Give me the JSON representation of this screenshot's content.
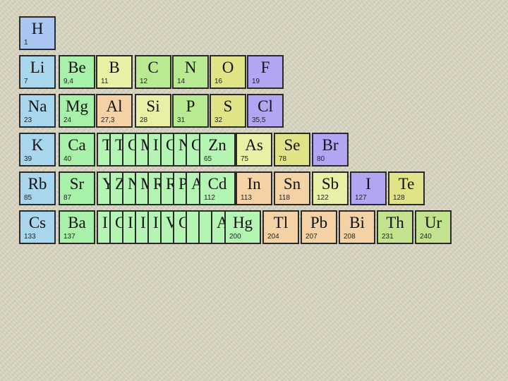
{
  "colors": {
    "background": "#dad6c2",
    "hydrogen": "#a9c6f3",
    "alkali": "#a8d6ec",
    "alkaline_earth": "#a8f1a8",
    "transition": "#b4f5b4",
    "post_transition": "#f4d2a6",
    "metalloid": "#e9f0a6",
    "nonmetal": "#b8ea92",
    "chalcogen": "#e0e386",
    "halogen": "#b2a6f4",
    "actinide": "#c2e28d"
  },
  "elements": [
    {
      "symbol": "H",
      "mass": "1",
      "color": "hydrogen"
    },
    {
      "symbol": "Li",
      "mass": "7",
      "color": "alkali"
    },
    {
      "symbol": "Be",
      "mass": "9,4",
      "color": "alkaline_earth"
    },
    {
      "symbol": "B",
      "mass": "11",
      "color": "metalloid"
    },
    {
      "symbol": "C",
      "mass": "12",
      "color": "nonmetal"
    },
    {
      "symbol": "N",
      "mass": "14",
      "color": "nonmetal"
    },
    {
      "symbol": "O",
      "mass": "16",
      "color": "chalcogen"
    },
    {
      "symbol": "F",
      "mass": "19",
      "color": "halogen"
    },
    {
      "symbol": "Na",
      "mass": "23",
      "color": "alkali"
    },
    {
      "symbol": "Mg",
      "mass": "24",
      "color": "alkaline_earth"
    },
    {
      "symbol": "Al",
      "mass": "27,3",
      "color": "post_transition"
    },
    {
      "symbol": "Si",
      "mass": "28",
      "color": "metalloid"
    },
    {
      "symbol": "P",
      "mass": "31",
      "color": "nonmetal"
    },
    {
      "symbol": "S",
      "mass": "32",
      "color": "chalcogen"
    },
    {
      "symbol": "Cl",
      "mass": "35,5",
      "color": "halogen"
    },
    {
      "symbol": "K",
      "mass": "39",
      "color": "alkali"
    },
    {
      "symbol": "Ca",
      "mass": "40",
      "color": "alkaline_earth"
    },
    {
      "symbol": "T",
      "mass": "",
      "color": "transition"
    },
    {
      "symbol": "T",
      "mass": "",
      "color": "transition"
    },
    {
      "symbol": "C",
      "mass": "",
      "color": "transition"
    },
    {
      "symbol": "M",
      "mass": "",
      "color": "transition"
    },
    {
      "symbol": "I",
      "mass": "",
      "color": "transition"
    },
    {
      "symbol": "C",
      "mass": "",
      "color": "transition"
    },
    {
      "symbol": "N",
      "mass": "",
      "color": "transition"
    },
    {
      "symbol": "C",
      "mass": "",
      "color": "transition"
    },
    {
      "symbol": "Zn",
      "mass": "65",
      "color": "transition"
    },
    {
      "symbol": "As",
      "mass": "75",
      "color": "metalloid"
    },
    {
      "symbol": "Se",
      "mass": "78",
      "color": "chalcogen"
    },
    {
      "symbol": "Br",
      "mass": "80",
      "color": "halogen"
    },
    {
      "symbol": "Rb",
      "mass": "85",
      "color": "alkali"
    },
    {
      "symbol": "Sr",
      "mass": "87",
      "color": "alkaline_earth"
    },
    {
      "symbol": "Y",
      "mass": "",
      "color": "transition"
    },
    {
      "symbol": "Z",
      "mass": "",
      "color": "transition"
    },
    {
      "symbol": "N",
      "mass": "",
      "color": "transition"
    },
    {
      "symbol": "M",
      "mass": "",
      "color": "transition"
    },
    {
      "symbol": "R",
      "mass": "",
      "color": "transition"
    },
    {
      "symbol": "R",
      "mass": "",
      "color": "transition"
    },
    {
      "symbol": "P",
      "mass": "",
      "color": "transition"
    },
    {
      "symbol": "A",
      "mass": "",
      "color": "transition"
    },
    {
      "symbol": "Cd",
      "mass": "112",
      "color": "transition"
    },
    {
      "symbol": "In",
      "mass": "113",
      "color": "post_transition"
    },
    {
      "symbol": "Sn",
      "mass": "118",
      "color": "post_transition"
    },
    {
      "symbol": "Sb",
      "mass": "122",
      "color": "metalloid"
    },
    {
      "symbol": "I",
      "mass": "127",
      "color": "halogen"
    },
    {
      "symbol": "Te",
      "mass": "128",
      "color": "chalcogen"
    },
    {
      "symbol": "Cs",
      "mass": "133",
      "color": "alkali"
    },
    {
      "symbol": "Ba",
      "mass": "137",
      "color": "alkaline_earth"
    },
    {
      "symbol": "I",
      "mass": "",
      "color": "transition"
    },
    {
      "symbol": "C",
      "mass": "",
      "color": "transition"
    },
    {
      "symbol": "I",
      "mass": "",
      "color": "transition"
    },
    {
      "symbol": "I",
      "mass": "",
      "color": "transition"
    },
    {
      "symbol": "I",
      "mass": "",
      "color": "transition"
    },
    {
      "symbol": "V",
      "mass": "",
      "color": "transition"
    },
    {
      "symbol": "C",
      "mass": "",
      "color": "transition"
    },
    {
      "symbol": "",
      "mass": "",
      "color": "transition"
    },
    {
      "symbol": "",
      "mass": "",
      "color": "transition"
    },
    {
      "symbol": "A",
      "mass": "",
      "color": "transition"
    },
    {
      "symbol": "Hg",
      "mass": "200",
      "color": "transition"
    },
    {
      "symbol": "Tl",
      "mass": "204",
      "color": "post_transition"
    },
    {
      "symbol": "Pb",
      "mass": "207",
      "color": "post_transition"
    },
    {
      "symbol": "Bi",
      "mass": "208",
      "color": "post_transition"
    },
    {
      "symbol": "Th",
      "mass": "231",
      "color": "actinide"
    },
    {
      "symbol": "Ur",
      "mass": "240",
      "color": "actinide"
    }
  ]
}
